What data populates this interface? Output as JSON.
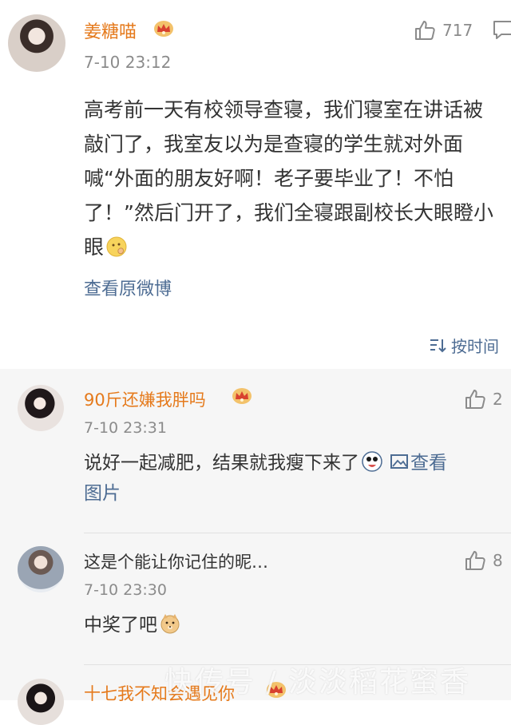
{
  "main_post": {
    "username": "姜糖喵",
    "timestamp": "7-10 23:12",
    "like_count": "717",
    "body": "高考前一天有校领导查寝，我们寝室在讲话被敲门了，我室友以为是查寝的学生就对外面喊“外面的朋友好啊！老子要毕业了！不怕了！”然后门开了，我们全寝跟副校长大眼瞪小眼",
    "view_original_label": "查看原微博",
    "sort_label": "按时间"
  },
  "comments": [
    {
      "username": "90斤还嫌我胖吗",
      "timestamp": "7-10 23:31",
      "text": "说好一起减肥，结果就我瘦下来了",
      "image_link_line1": "查看",
      "image_link_line2": "图片",
      "like_count": "2"
    },
    {
      "username": "",
      "timestamp": "7-10 23:30",
      "text_top": "这是个能让你记住的昵…",
      "text": "中奖了吧",
      "like_count": "8"
    },
    {
      "username": "十七我不知会遇见你",
      "timestamp": "",
      "text": ""
    }
  ],
  "watermark": "快传号 / 淡淡稻花蜜香",
  "colors": {
    "username": "#e57a1c",
    "link": "#4d6c93",
    "meta": "#8b8b8b",
    "comment_bg": "#f6f6f6"
  }
}
